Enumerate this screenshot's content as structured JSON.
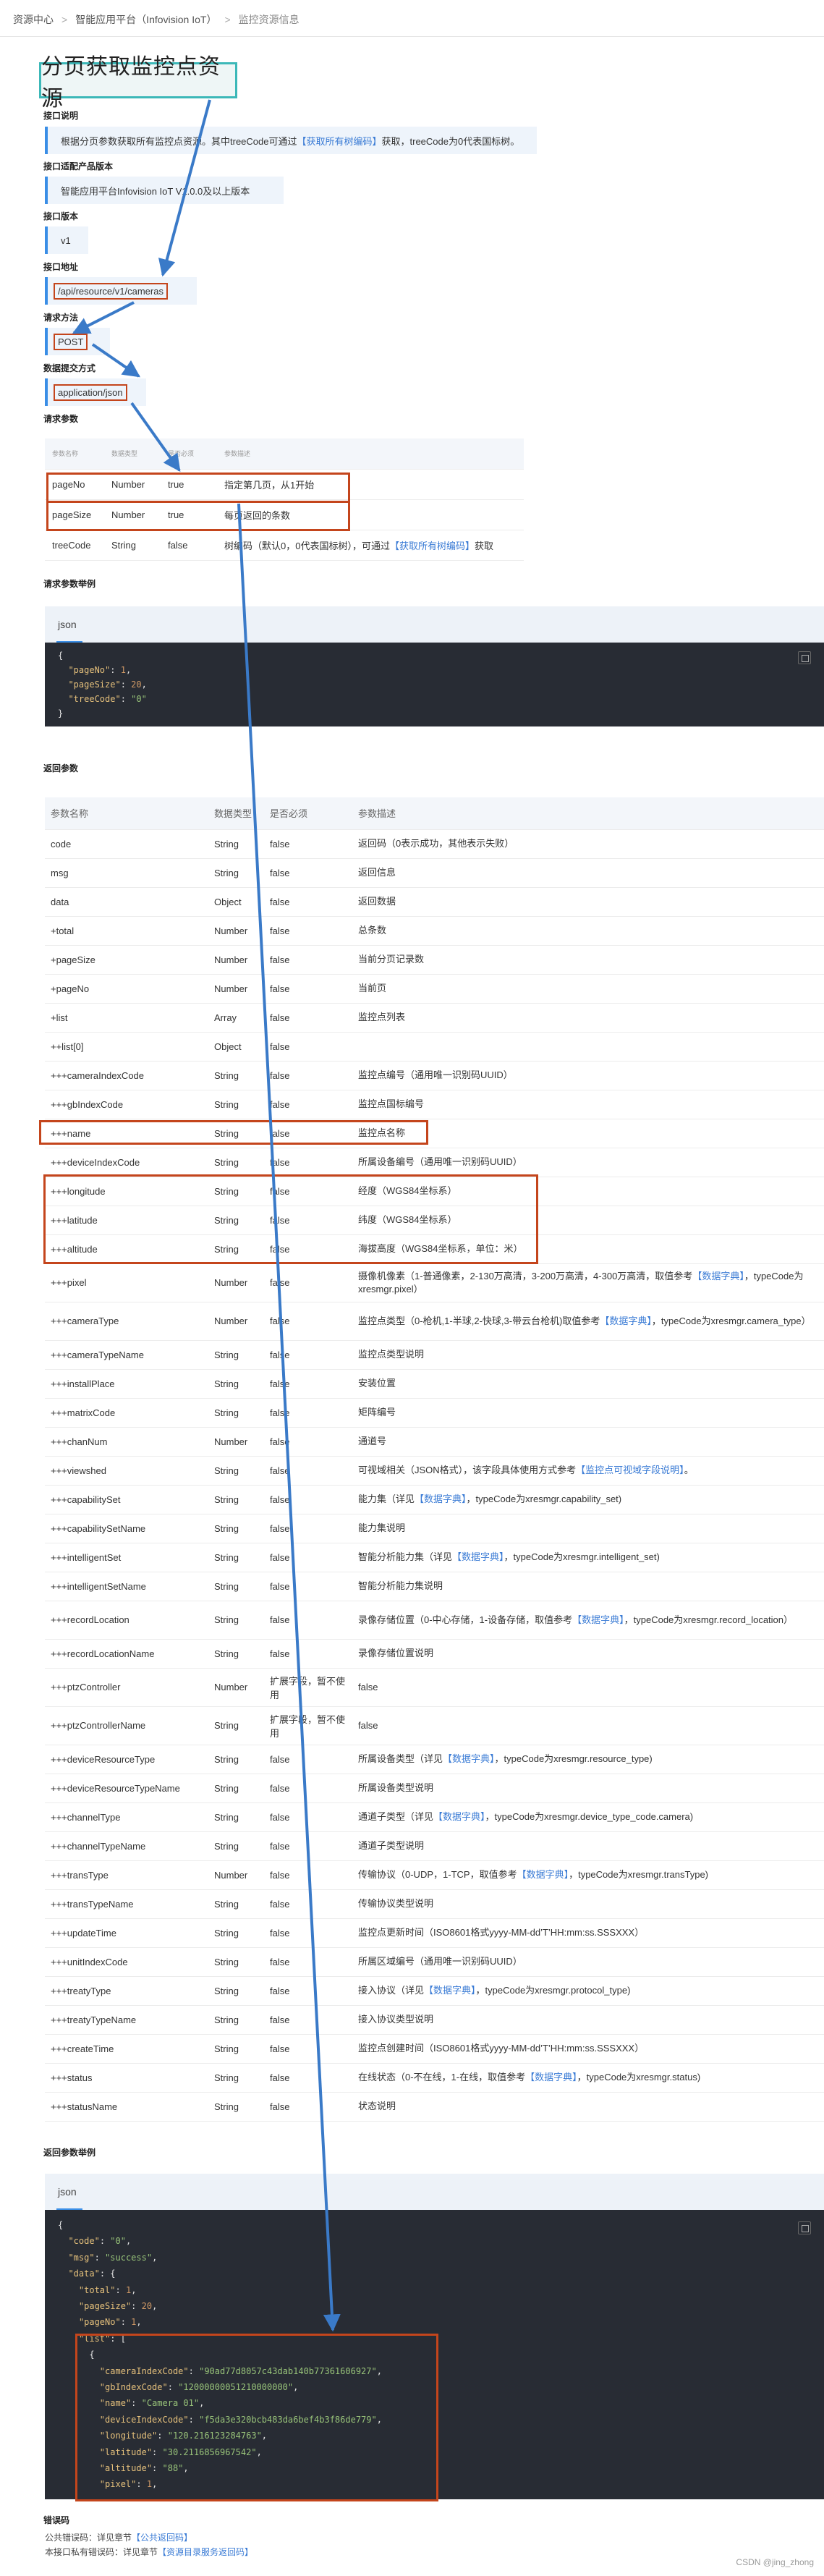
{
  "breadcrumb": {
    "items": [
      "资源中心",
      "智能应用平台（Infovision IoT）",
      "监控资源信息"
    ]
  },
  "title": "分页获取监控点资源",
  "sections": {
    "desc_title": "接口说明",
    "desc_pre": "根据分页参数获取所有监控点资源。其中treeCode可通过",
    "desc_link": "【获取所有树编码】",
    "desc_post": "获取，treeCode为0代表国标树。",
    "product_title": "接口适配产品版本",
    "product": "智能应用平台Infovision IoT V1.0.0及以上版本",
    "version_title": "接口版本",
    "version": "v1",
    "address_title": "接口地址",
    "address": "/api/resource/v1/cameras",
    "method_title": "请求方法",
    "method": "POST",
    "submit_title": "数据提交方式",
    "submit": "application/json",
    "params_title": "请求参数",
    "req_example_title": "请求参数举例",
    "resp_params_title": "返回参数",
    "resp_example_title": "返回参数举例",
    "errors_title": "错误码"
  },
  "req_table": {
    "headers": [
      "参数名称",
      "数据类型",
      "是否必须",
      "参数描述"
    ],
    "rows": [
      {
        "name": "pageNo",
        "type": "Number",
        "req": "true",
        "desc": "指定第几页，从1开始"
      },
      {
        "name": "pageSize",
        "type": "Number",
        "req": "true",
        "desc": "每页返回的条数"
      },
      {
        "name": "treeCode",
        "type": "String",
        "req": "false",
        "desc": "树编码（默认0，0代表国标树），可通过",
        "link": "【获取所有树编码】",
        "post": "获取"
      }
    ]
  },
  "req_code": {
    "lang": "json",
    "lines": [
      "{",
      "  \"pageNo\": 1,",
      "  \"pageSize\": 20,",
      "  \"treeCode\": \"0\"",
      "}"
    ]
  },
  "resp_table": {
    "headers": [
      "参数名称",
      "数据类型",
      "是否必须",
      "参数描述"
    ],
    "rows": [
      {
        "name": "code",
        "type": "String",
        "req": "false",
        "desc": "返回码（0表示成功，其他表示失败）"
      },
      {
        "name": "msg",
        "type": "String",
        "req": "false",
        "desc": "返回信息"
      },
      {
        "name": "data",
        "type": "Object",
        "req": "false",
        "desc": "返回数据"
      },
      {
        "name": "+total",
        "type": "Number",
        "req": "false",
        "desc": "总条数"
      },
      {
        "name": "+pageSize",
        "type": "Number",
        "req": "false",
        "desc": "当前分页记录数"
      },
      {
        "name": "+pageNo",
        "type": "Number",
        "req": "false",
        "desc": "当前页"
      },
      {
        "name": "+list",
        "type": "Array",
        "req": "false",
        "desc": "监控点列表"
      },
      {
        "name": "++list[0]",
        "type": "Object",
        "req": "false",
        "desc": ""
      },
      {
        "name": "+++cameraIndexCode",
        "type": "String",
        "req": "false",
        "desc": "监控点编号（通用唯一识别码UUID）"
      },
      {
        "name": "+++gbIndexCode",
        "type": "String",
        "req": "false",
        "desc": "监控点国标编号"
      },
      {
        "name": "+++name",
        "type": "String",
        "req": "false",
        "desc": "监控点名称"
      },
      {
        "name": "+++deviceIndexCode",
        "type": "String",
        "req": "false",
        "desc": "所属设备编号（通用唯一识别码UUID）"
      },
      {
        "name": "+++longitude",
        "type": "String",
        "req": "false",
        "desc": "经度（WGS84坐标系）"
      },
      {
        "name": "+++latitude",
        "type": "String",
        "req": "false",
        "desc": "纬度（WGS84坐标系）"
      },
      {
        "name": "+++altitude",
        "type": "String",
        "req": "false",
        "desc": "海拔高度（WGS84坐标系，单位：米）"
      },
      {
        "name": "+++pixel",
        "type": "Number",
        "req": "false",
        "desc": "摄像机像素（1-普通像素，2-130万高清，3-200万高清，4-300万高清，取值参考",
        "link": "【数据字典】",
        "post": "，typeCode为xresmgr.pixel）",
        "tall": true
      },
      {
        "name": "+++cameraType",
        "type": "Number",
        "req": "false",
        "desc": "监控点类型（0-枪机,1-半球,2-快球,3-带云台枪机)取值参考",
        "link": "【数据字典】",
        "post": "，typeCode为xresmgr.camera_type）",
        "tall": true
      },
      {
        "name": "+++cameraTypeName",
        "type": "String",
        "req": "false",
        "desc": "监控点类型说明"
      },
      {
        "name": "+++installPlace",
        "type": "String",
        "req": "false",
        "desc": "安装位置"
      },
      {
        "name": "+++matrixCode",
        "type": "String",
        "req": "false",
        "desc": "矩阵编号"
      },
      {
        "name": "+++chanNum",
        "type": "Number",
        "req": "false",
        "desc": "通道号"
      },
      {
        "name": "+++viewshed",
        "type": "String",
        "req": "false",
        "desc": "可视域相关（JSON格式），该字段具体使用方式参考",
        "link": "【监控点可视域字段说明】",
        "post": "。"
      },
      {
        "name": "+++capabilitySet",
        "type": "String",
        "req": "false",
        "desc": "能力集（详见",
        "link": "【数据字典】",
        "post": "，typeCode为xresmgr.capability_set)"
      },
      {
        "name": "+++capabilitySetName",
        "type": "String",
        "req": "false",
        "desc": "能力集说明"
      },
      {
        "name": "+++intelligentSet",
        "type": "String",
        "req": "false",
        "desc": "智能分析能力集（详见",
        "link": "【数据字典】",
        "post": "，typeCode为xresmgr.intelligent_set)"
      },
      {
        "name": "+++intelligentSetName",
        "type": "String",
        "req": "false",
        "desc": "智能分析能力集说明"
      },
      {
        "name": "+++recordLocation",
        "type": "String",
        "req": "false",
        "desc": "录像存储位置（0-中心存储，1-设备存储，取值参考",
        "link": "【数据字典】",
        "post": "，typeCode为xresmgr.record_location）",
        "tall": true
      },
      {
        "name": "+++recordLocationName",
        "type": "String",
        "req": "false",
        "desc": "录像存储位置说明"
      },
      {
        "name": "+++ptzController",
        "type": "Number",
        "req": "扩展字段，暂不使用",
        "desc": "false",
        "tall": true
      },
      {
        "name": "+++ptzControllerName",
        "type": "String",
        "req": "扩展字段，暂不使用",
        "desc": "false",
        "tall": true
      },
      {
        "name": "+++deviceResourceType",
        "type": "String",
        "req": "false",
        "desc": "所属设备类型（详见",
        "link": "【数据字典】",
        "post": "，typeCode为xresmgr.resource_type)"
      },
      {
        "name": "+++deviceResourceTypeName",
        "type": "String",
        "req": "false",
        "desc": "所属设备类型说明"
      },
      {
        "name": "+++channelType",
        "type": "String",
        "req": "false",
        "desc": "通道子类型（详见",
        "link": "【数据字典】",
        "post": "，typeCode为xresmgr.device_type_code.camera)"
      },
      {
        "name": "+++channelTypeName",
        "type": "String",
        "req": "false",
        "desc": "通道子类型说明"
      },
      {
        "name": "+++transType",
        "type": "Number",
        "req": "false",
        "desc": "传输协议（0-UDP，1-TCP，取值参考",
        "link": "【数据字典】",
        "post": "，typeCode为xresmgr.transType)"
      },
      {
        "name": "+++transTypeName",
        "type": "String",
        "req": "false",
        "desc": "传输协议类型说明"
      },
      {
        "name": "+++updateTime",
        "type": "String",
        "req": "false",
        "desc": "监控点更新时间（ISO8601格式yyyy-MM-dd’T’HH:mm:ss.SSSXXX）"
      },
      {
        "name": "+++unitIndexCode",
        "type": "String",
        "req": "false",
        "desc": "所属区域编号（通用唯一识别码UUID）"
      },
      {
        "name": "+++treatyType",
        "type": "String",
        "req": "false",
        "desc": "接入协议（详见",
        "link": "【数据字典】",
        "post": "，typeCode为xresmgr.protocol_type)"
      },
      {
        "name": "+++treatyTypeName",
        "type": "String",
        "req": "false",
        "desc": "接入协议类型说明"
      },
      {
        "name": "+++createTime",
        "type": "String",
        "req": "false",
        "desc": "监控点创建时间（ISO8601格式yyyy-MM-dd’T’HH:mm:ss.SSSXXX）"
      },
      {
        "name": "+++status",
        "type": "String",
        "req": "false",
        "desc": "在线状态（0-不在线，1-在线，取值参考",
        "link": "【数据字典】",
        "post": "，typeCode为xresmgr.status)"
      },
      {
        "name": "+++statusName",
        "type": "String",
        "req": "false",
        "desc": "状态说明"
      }
    ]
  },
  "resp_code": {
    "lang": "json",
    "lines": [
      "{",
      "  \"code\": \"0\",",
      "  \"msg\": \"success\",",
      "  \"data\": {",
      "    \"total\": 1,",
      "    \"pageSize\": 20,",
      "    \"pageNo\": 1,",
      "    \"list\": [",
      "      {",
      "        \"cameraIndexCode\": \"90ad77d8057c43dab140b77361606927\",",
      "        \"gbIndexCode\": \"12000000051210000000\",",
      "        \"name\": \"Camera 01\",",
      "        \"deviceIndexCode\": \"f5da3e320bcb483da6bef4b3f86de779\",",
      "        \"longitude\": \"120.216123284763\",",
      "        \"latitude\": \"30.2116856967542\",",
      "        \"altitude\": \"88\",",
      "        \"pixel\": 1,"
    ]
  },
  "errors": {
    "public_pre": "公共错误码：详见章节",
    "public_link": "【公共返回码】",
    "private_pre": "本接口私有错误码：详见章节",
    "private_link": "【资源目录服务返回码】"
  },
  "watermark": "CSDN @jing_zhong",
  "colors": {
    "accent": "#3a8ee6",
    "highlight": "#c4451c",
    "title_border": "#3cb8b8",
    "code_bg": "#282c34"
  }
}
